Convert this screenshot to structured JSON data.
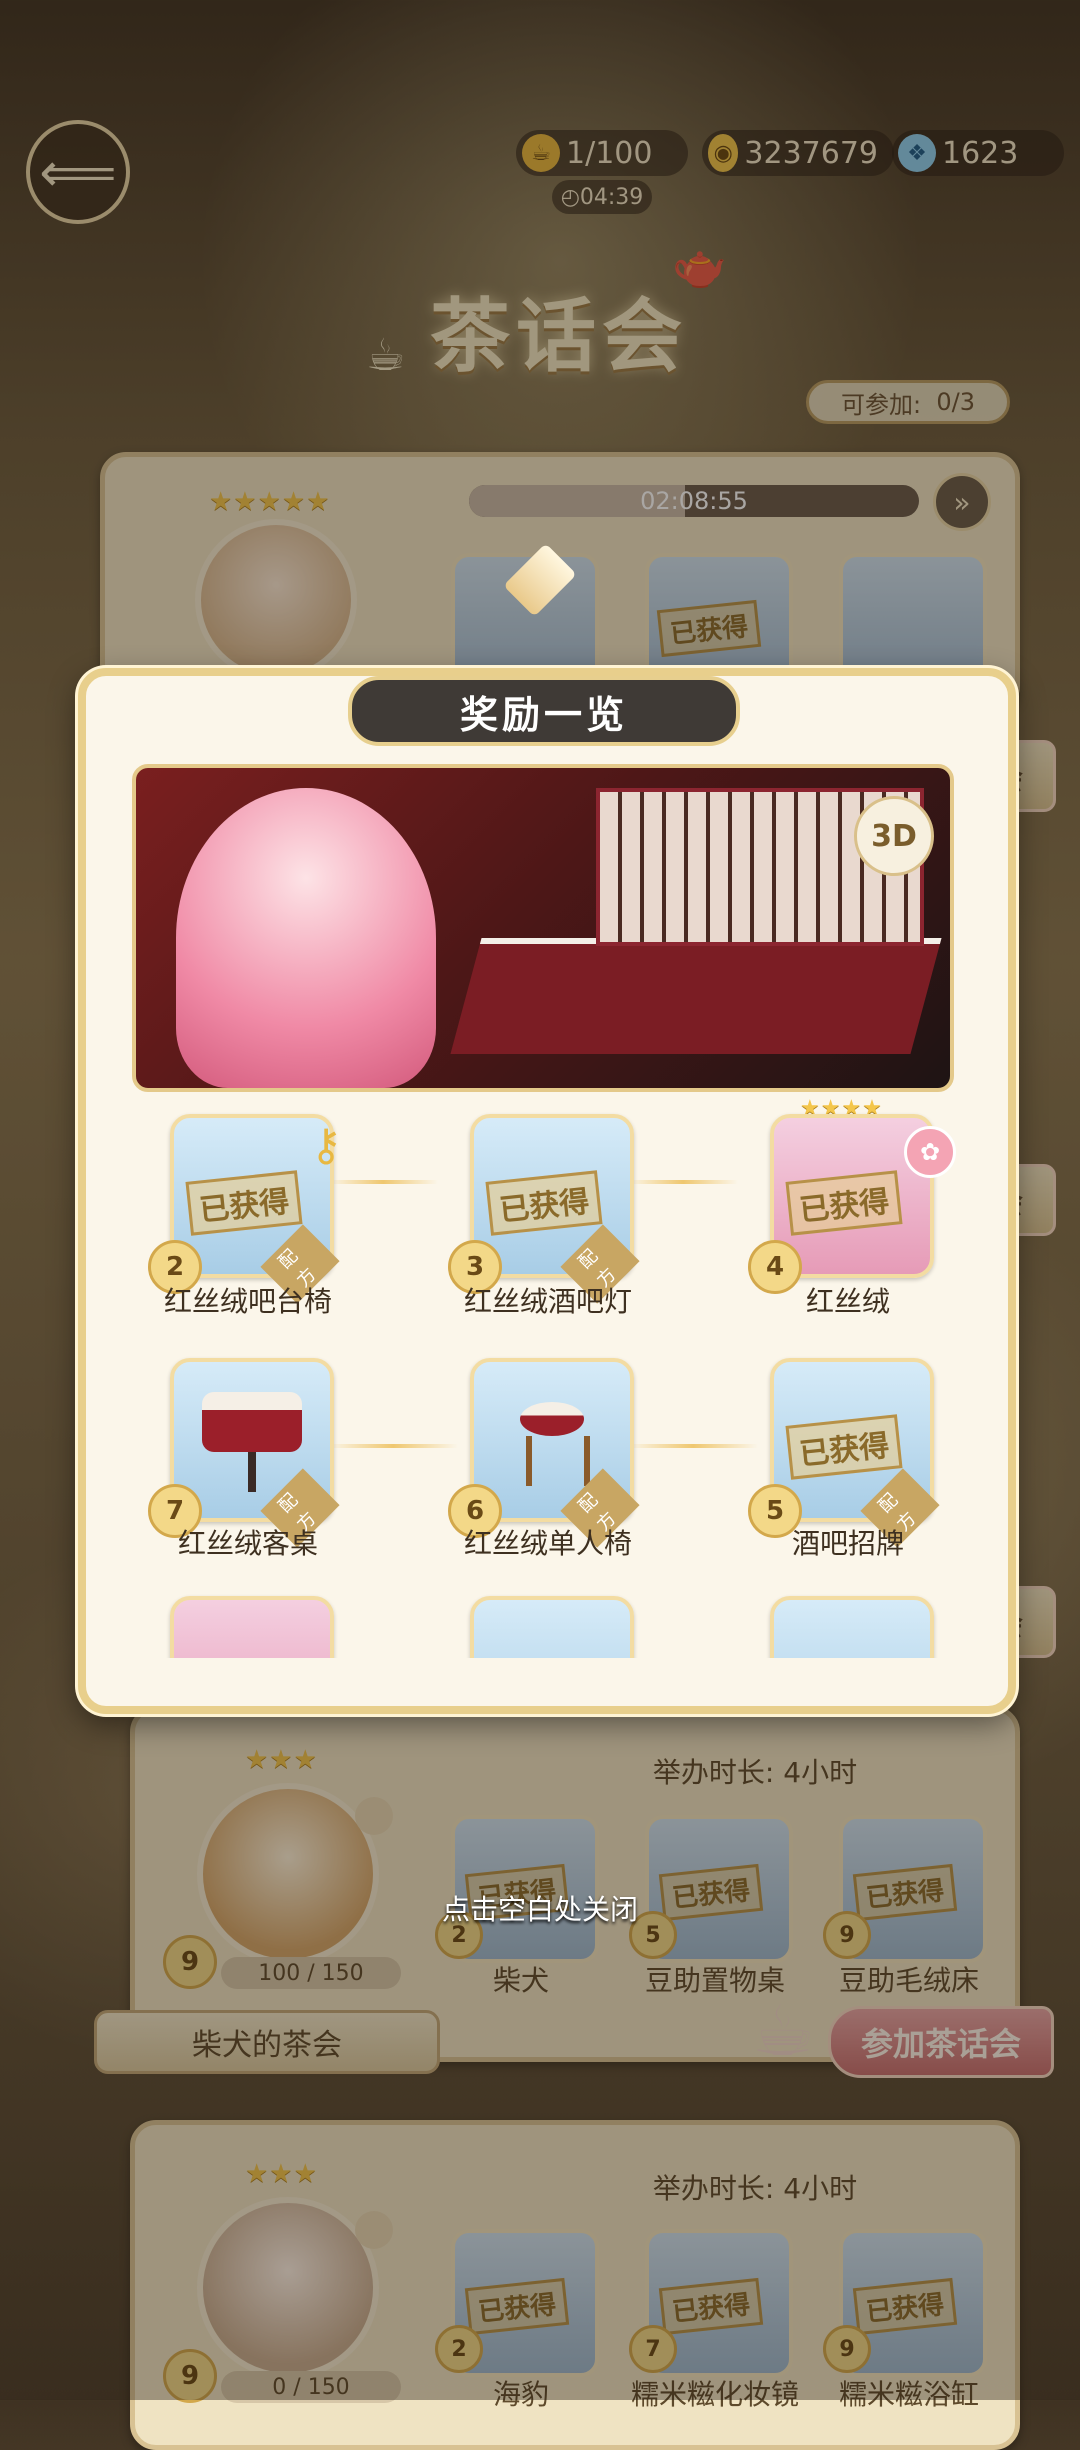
{
  "topbar": {
    "back_icon": "leaf-arrow-left-icon",
    "resources": [
      {
        "icon": "tea-token-icon",
        "value": "1/100"
      },
      {
        "icon": "gold-coin-icon",
        "value": "3237679"
      },
      {
        "icon": "diamond-icon",
        "value": "1623"
      }
    ],
    "timer": "◴04:39"
  },
  "page_title": "茶话会",
  "join_count": {
    "label": "可参加:",
    "value": "0/3"
  },
  "card1": {
    "countdown": "02:08:55",
    "stamp": "已获得"
  },
  "side_peek": [
    "会",
    "会",
    "会"
  ],
  "card2": {
    "duration": "举办时长: 4小时",
    "level": "9",
    "progress": "100 / 150",
    "items": [
      {
        "level": "2",
        "name": "柴犬",
        "stamp": "已获得"
      },
      {
        "level": "5",
        "name": "豆助置物桌",
        "stamp": "已获得"
      },
      {
        "level": "9",
        "name": "豆助毛绒床",
        "stamp": "已获得"
      }
    ],
    "party_name": "柴犬的茶会",
    "join_button": "参加茶话会"
  },
  "card3": {
    "duration": "举办时长: 4小时",
    "level": "9",
    "progress": "0 / 150",
    "items": [
      {
        "level": "2",
        "name": "海豹",
        "stamp": "已获得"
      },
      {
        "level": "7",
        "name": "糯米糍化妆镜",
        "stamp": "已获得"
      },
      {
        "level": "9",
        "name": "糯米糍浴缸",
        "stamp": "已获得"
      }
    ]
  },
  "modal": {
    "title": "奖励一览",
    "badge_3d": "3D",
    "recipe_tag": "配方",
    "rewards": [
      {
        "level": "2",
        "name": "红丝绒吧台椅",
        "stamp": "已获得"
      },
      {
        "level": "3",
        "name": "红丝绒酒吧灯",
        "stamp": "已获得"
      },
      {
        "level": "4",
        "name": "红丝绒",
        "stamp": "已获得"
      },
      {
        "level": "7",
        "name": "红丝绒客桌",
        "stamp": ""
      },
      {
        "level": "6",
        "name": "红丝绒单人椅",
        "stamp": ""
      },
      {
        "level": "5",
        "name": "酒吧招牌",
        "stamp": "已获得"
      }
    ]
  },
  "close_tip": "点击空白处关闭"
}
